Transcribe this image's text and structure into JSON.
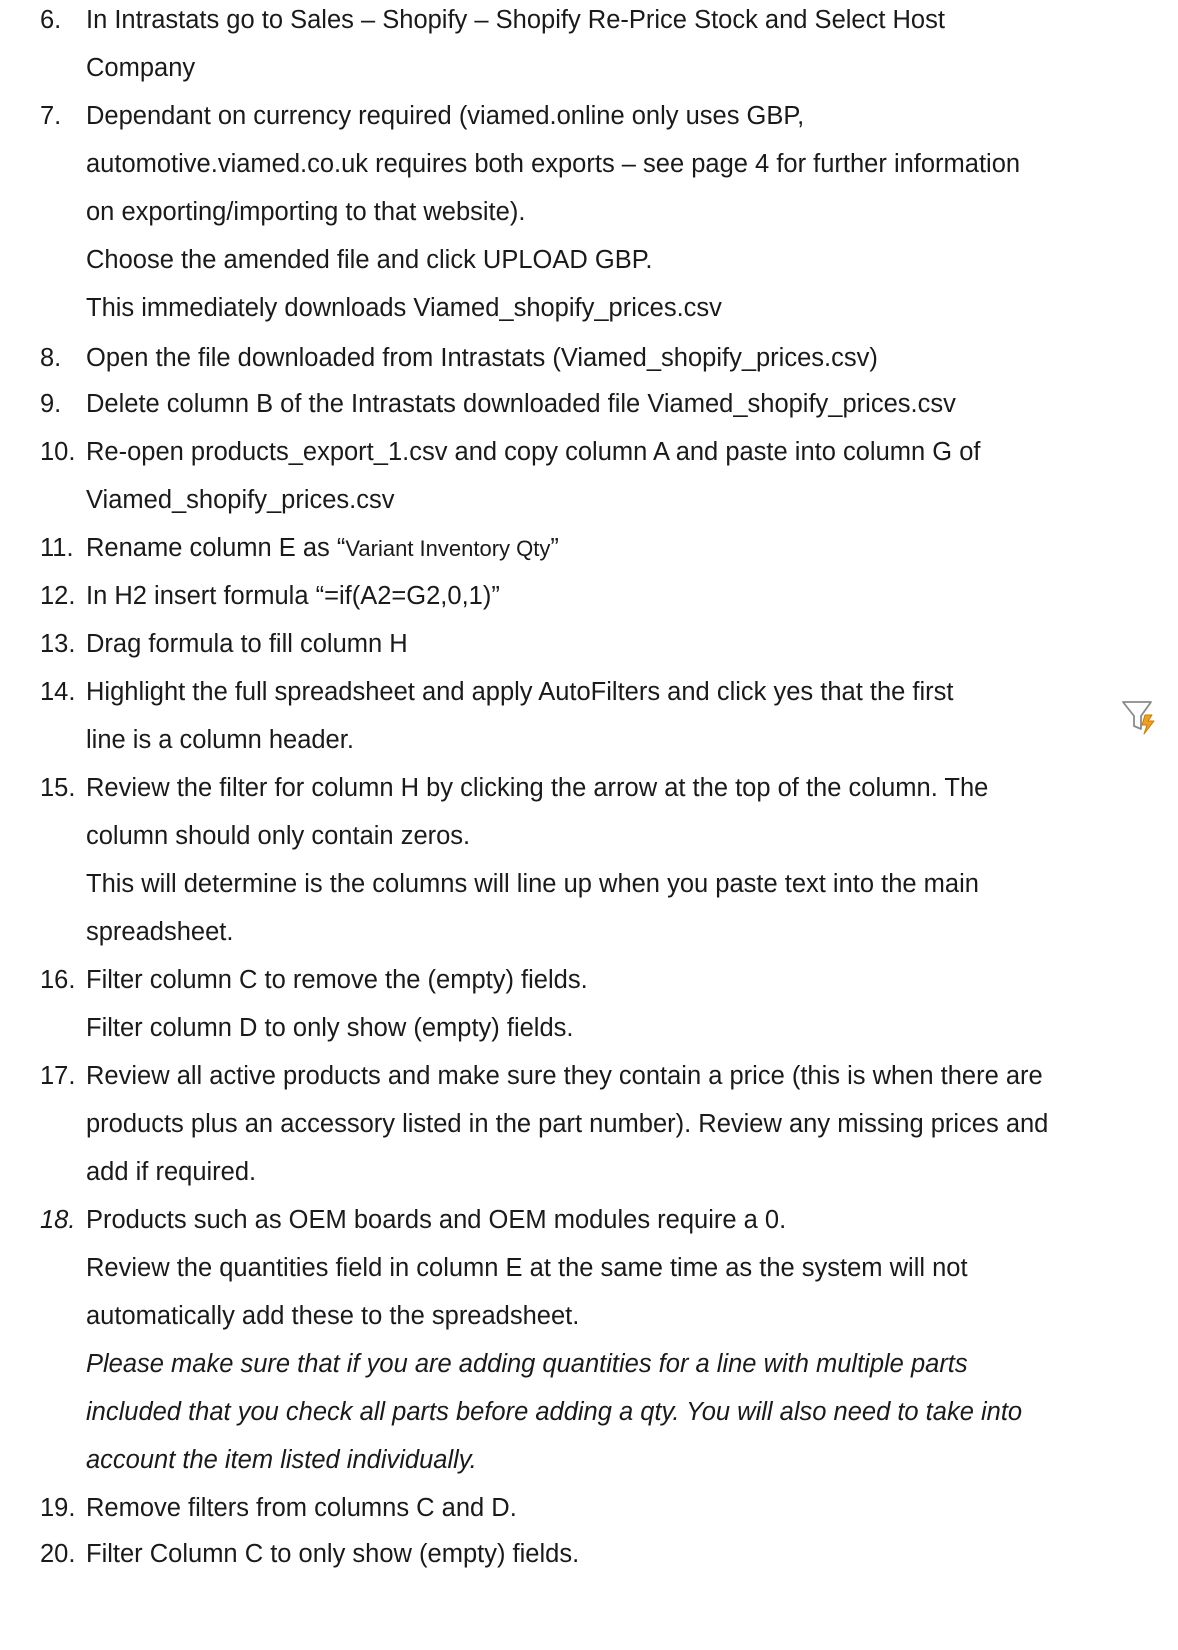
{
  "steps": [
    {
      "num": "6.",
      "lines": [
        "In Intrastats go to Sales – Shopify – Shopify Re-Price Stock and Select Host",
        "Company"
      ]
    },
    {
      "num": "7.",
      "lines": [
        "Dependant on currency required (viamed.online only uses GBP,",
        "automotive.viamed.co.uk requires both exports – see page 4 for further information",
        "on exporting/importing to that website).",
        "Choose the amended file and click UPLOAD GBP.",
        "This immediately downloads Viamed_shopify_prices.csv"
      ]
    },
    {
      "num": "8.",
      "lines": [
        "Open the file downloaded from Intrastats (Viamed_shopify_prices.csv)"
      ]
    },
    {
      "num": "9.",
      "lines": [
        "Delete column B of the Intrastats downloaded file Viamed_shopify_prices.csv"
      ]
    },
    {
      "num": "10.",
      "lines": [
        "Re-open products_export_1.csv and copy column A and paste into column G of",
        "Viamed_shopify_prices.csv"
      ]
    },
    {
      "num": "11.",
      "lines": [
        "Rename column E as “",
        "Variant Inventory Qty",
        "”"
      ]
    },
    {
      "num": "12.",
      "lines": [
        "In H2 insert formula “=if(A2=G2,0,1)”"
      ]
    },
    {
      "num": "13.",
      "lines": [
        "Drag formula to fill column H"
      ]
    },
    {
      "num": "14.",
      "lines": [
        "Highlight the full spreadsheet and apply AutoFilters and click yes that the first",
        "line is a column header."
      ]
    },
    {
      "num": "15.",
      "lines": [
        "Review the filter for column H by clicking the arrow at the top of the column. The",
        "column should only contain zeros.",
        "This will determine is the columns will line up when you paste text into the main",
        "spreadsheet."
      ]
    },
    {
      "num": "16.",
      "lines": [
        "Filter column C to remove the (empty) fields.",
        "Filter column D to only show (empty) fields."
      ]
    },
    {
      "num": "17.",
      "lines": [
        "Review all active products and make sure they contain a price (this is when there are",
        "products plus an accessory listed in the part number). Review any missing prices and",
        "add if required."
      ]
    },
    {
      "num": "18.",
      "lines": [
        "Products such as OEM boards and OEM modules require a 0.",
        "Review the quantities field in column E at the same time as the system will not",
        "automatically add these to the spreadsheet.",
        "Please make sure that if you are adding quantities for a line with multiple parts",
        "included that you check all parts before adding a qty. You will also need to take into",
        "account the item listed individually."
      ]
    },
    {
      "num": "19.",
      "lines": [
        "Remove filters from columns C and D."
      ]
    },
    {
      "num": "20.",
      "lines": [
        "Filter Column C to only show (empty) fields."
      ]
    }
  ],
  "icons": {
    "autofilter": "autofilter-icon",
    "autofilter_colors": {
      "funnel": "#8a8a8a",
      "bolt": "#f0a020",
      "bolt_outline": "#c77a00"
    }
  }
}
